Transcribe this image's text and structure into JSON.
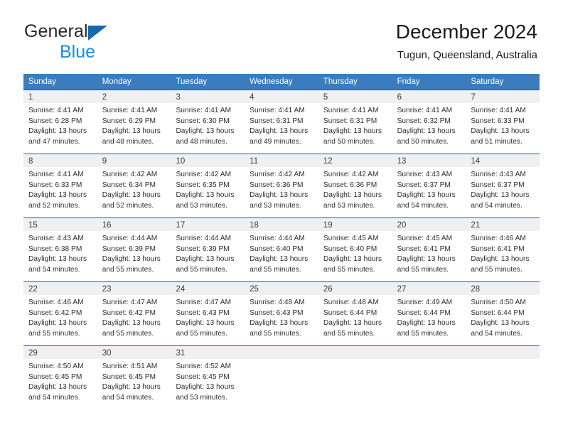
{
  "brand": {
    "name_top": "General",
    "name_bottom": "Blue",
    "triangle_color": "#1268b3",
    "blue_color": "#1b8ae0"
  },
  "header": {
    "title": "December 2024",
    "subtitle": "Tugun, Queensland, Australia"
  },
  "colors": {
    "header_row_bg": "#3a7cbe",
    "row_divider": "#1f5fa0",
    "day_band_bg": "#f0f0f0",
    "text": "#2e2e2e"
  },
  "weekdays": [
    "Sunday",
    "Monday",
    "Tuesday",
    "Wednesday",
    "Thursday",
    "Friday",
    "Saturday"
  ],
  "weeks": [
    [
      {
        "day": "1",
        "sunrise": "Sunrise: 4:41 AM",
        "sunset": "Sunset: 6:28 PM",
        "daylight1": "Daylight: 13 hours",
        "daylight2": "and 47 minutes."
      },
      {
        "day": "2",
        "sunrise": "Sunrise: 4:41 AM",
        "sunset": "Sunset: 6:29 PM",
        "daylight1": "Daylight: 13 hours",
        "daylight2": "and 48 minutes."
      },
      {
        "day": "3",
        "sunrise": "Sunrise: 4:41 AM",
        "sunset": "Sunset: 6:30 PM",
        "daylight1": "Daylight: 13 hours",
        "daylight2": "and 48 minutes."
      },
      {
        "day": "4",
        "sunrise": "Sunrise: 4:41 AM",
        "sunset": "Sunset: 6:31 PM",
        "daylight1": "Daylight: 13 hours",
        "daylight2": "and 49 minutes."
      },
      {
        "day": "5",
        "sunrise": "Sunrise: 4:41 AM",
        "sunset": "Sunset: 6:31 PM",
        "daylight1": "Daylight: 13 hours",
        "daylight2": "and 50 minutes."
      },
      {
        "day": "6",
        "sunrise": "Sunrise: 4:41 AM",
        "sunset": "Sunset: 6:32 PM",
        "daylight1": "Daylight: 13 hours",
        "daylight2": "and 50 minutes."
      },
      {
        "day": "7",
        "sunrise": "Sunrise: 4:41 AM",
        "sunset": "Sunset: 6:33 PM",
        "daylight1": "Daylight: 13 hours",
        "daylight2": "and 51 minutes."
      }
    ],
    [
      {
        "day": "8",
        "sunrise": "Sunrise: 4:41 AM",
        "sunset": "Sunset: 6:33 PM",
        "daylight1": "Daylight: 13 hours",
        "daylight2": "and 52 minutes."
      },
      {
        "day": "9",
        "sunrise": "Sunrise: 4:42 AM",
        "sunset": "Sunset: 6:34 PM",
        "daylight1": "Daylight: 13 hours",
        "daylight2": "and 52 minutes."
      },
      {
        "day": "10",
        "sunrise": "Sunrise: 4:42 AM",
        "sunset": "Sunset: 6:35 PM",
        "daylight1": "Daylight: 13 hours",
        "daylight2": "and 53 minutes."
      },
      {
        "day": "11",
        "sunrise": "Sunrise: 4:42 AM",
        "sunset": "Sunset: 6:36 PM",
        "daylight1": "Daylight: 13 hours",
        "daylight2": "and 53 minutes."
      },
      {
        "day": "12",
        "sunrise": "Sunrise: 4:42 AM",
        "sunset": "Sunset: 6:36 PM",
        "daylight1": "Daylight: 13 hours",
        "daylight2": "and 53 minutes."
      },
      {
        "day": "13",
        "sunrise": "Sunrise: 4:43 AM",
        "sunset": "Sunset: 6:37 PM",
        "daylight1": "Daylight: 13 hours",
        "daylight2": "and 54 minutes."
      },
      {
        "day": "14",
        "sunrise": "Sunrise: 4:43 AM",
        "sunset": "Sunset: 6:37 PM",
        "daylight1": "Daylight: 13 hours",
        "daylight2": "and 54 minutes."
      }
    ],
    [
      {
        "day": "15",
        "sunrise": "Sunrise: 4:43 AM",
        "sunset": "Sunset: 6:38 PM",
        "daylight1": "Daylight: 13 hours",
        "daylight2": "and 54 minutes."
      },
      {
        "day": "16",
        "sunrise": "Sunrise: 4:44 AM",
        "sunset": "Sunset: 6:39 PM",
        "daylight1": "Daylight: 13 hours",
        "daylight2": "and 55 minutes."
      },
      {
        "day": "17",
        "sunrise": "Sunrise: 4:44 AM",
        "sunset": "Sunset: 6:39 PM",
        "daylight1": "Daylight: 13 hours",
        "daylight2": "and 55 minutes."
      },
      {
        "day": "18",
        "sunrise": "Sunrise: 4:44 AM",
        "sunset": "Sunset: 6:40 PM",
        "daylight1": "Daylight: 13 hours",
        "daylight2": "and 55 minutes."
      },
      {
        "day": "19",
        "sunrise": "Sunrise: 4:45 AM",
        "sunset": "Sunset: 6:40 PM",
        "daylight1": "Daylight: 13 hours",
        "daylight2": "and 55 minutes."
      },
      {
        "day": "20",
        "sunrise": "Sunrise: 4:45 AM",
        "sunset": "Sunset: 6:41 PM",
        "daylight1": "Daylight: 13 hours",
        "daylight2": "and 55 minutes."
      },
      {
        "day": "21",
        "sunrise": "Sunrise: 4:46 AM",
        "sunset": "Sunset: 6:41 PM",
        "daylight1": "Daylight: 13 hours",
        "daylight2": "and 55 minutes."
      }
    ],
    [
      {
        "day": "22",
        "sunrise": "Sunrise: 4:46 AM",
        "sunset": "Sunset: 6:42 PM",
        "daylight1": "Daylight: 13 hours",
        "daylight2": "and 55 minutes."
      },
      {
        "day": "23",
        "sunrise": "Sunrise: 4:47 AM",
        "sunset": "Sunset: 6:42 PM",
        "daylight1": "Daylight: 13 hours",
        "daylight2": "and 55 minutes."
      },
      {
        "day": "24",
        "sunrise": "Sunrise: 4:47 AM",
        "sunset": "Sunset: 6:43 PM",
        "daylight1": "Daylight: 13 hours",
        "daylight2": "and 55 minutes."
      },
      {
        "day": "25",
        "sunrise": "Sunrise: 4:48 AM",
        "sunset": "Sunset: 6:43 PM",
        "daylight1": "Daylight: 13 hours",
        "daylight2": "and 55 minutes."
      },
      {
        "day": "26",
        "sunrise": "Sunrise: 4:48 AM",
        "sunset": "Sunset: 6:44 PM",
        "daylight1": "Daylight: 13 hours",
        "daylight2": "and 55 minutes."
      },
      {
        "day": "27",
        "sunrise": "Sunrise: 4:49 AM",
        "sunset": "Sunset: 6:44 PM",
        "daylight1": "Daylight: 13 hours",
        "daylight2": "and 55 minutes."
      },
      {
        "day": "28",
        "sunrise": "Sunrise: 4:50 AM",
        "sunset": "Sunset: 6:44 PM",
        "daylight1": "Daylight: 13 hours",
        "daylight2": "and 54 minutes."
      }
    ],
    [
      {
        "day": "29",
        "sunrise": "Sunrise: 4:50 AM",
        "sunset": "Sunset: 6:45 PM",
        "daylight1": "Daylight: 13 hours",
        "daylight2": "and 54 minutes."
      },
      {
        "day": "30",
        "sunrise": "Sunrise: 4:51 AM",
        "sunset": "Sunset: 6:45 PM",
        "daylight1": "Daylight: 13 hours",
        "daylight2": "and 54 minutes."
      },
      {
        "day": "31",
        "sunrise": "Sunrise: 4:52 AM",
        "sunset": "Sunset: 6:45 PM",
        "daylight1": "Daylight: 13 hours",
        "daylight2": "and 53 minutes."
      },
      {
        "day": "",
        "sunrise": "",
        "sunset": "",
        "daylight1": "",
        "daylight2": ""
      },
      {
        "day": "",
        "sunrise": "",
        "sunset": "",
        "daylight1": "",
        "daylight2": ""
      },
      {
        "day": "",
        "sunrise": "",
        "sunset": "",
        "daylight1": "",
        "daylight2": ""
      },
      {
        "day": "",
        "sunrise": "",
        "sunset": "",
        "daylight1": "",
        "daylight2": ""
      }
    ]
  ]
}
